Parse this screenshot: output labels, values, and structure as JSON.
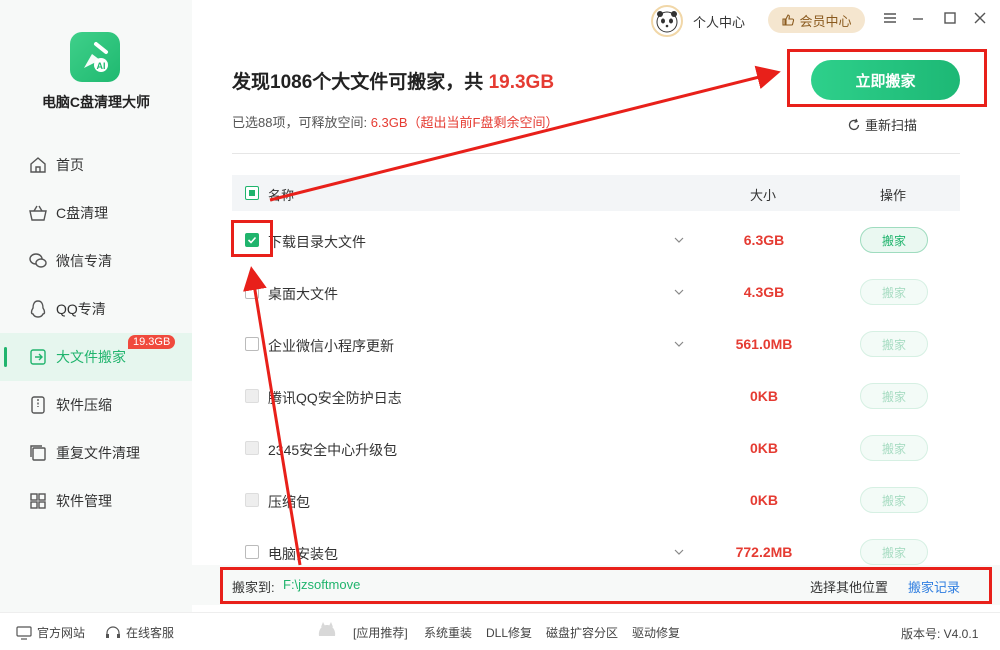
{
  "app": {
    "name": "电脑C盘清理大师",
    "logo_text": "AI"
  },
  "sidebar": {
    "items": [
      {
        "label": "首页",
        "icon": "home-icon"
      },
      {
        "label": "C盘清理",
        "icon": "basket-icon"
      },
      {
        "label": "微信专清",
        "icon": "wechat-icon"
      },
      {
        "label": "QQ专清",
        "icon": "qq-icon"
      },
      {
        "label": "大文件搬家",
        "icon": "move-file-icon",
        "badge": "19.3GB",
        "active": true
      },
      {
        "label": "软件压缩",
        "icon": "compress-icon"
      },
      {
        "label": "重复文件清理",
        "icon": "duplicate-icon"
      },
      {
        "label": "软件管理",
        "icon": "apps-icon"
      }
    ]
  },
  "topbar": {
    "user_center": "个人中心",
    "vip_label": "会员中心"
  },
  "main": {
    "heading_prefix": "发现1086个大文件可搬家，共 ",
    "heading_total": "19.3GB",
    "sub_prefix": "已选88项，可释放空间: ",
    "sub_free": "6.3GB",
    "sub_note": "（超出当前F盘剩余空间）",
    "move_now": "立即搬家",
    "rescan": "重新扫描"
  },
  "table": {
    "headers": {
      "name": "名称",
      "size": "大小",
      "op": "操作"
    },
    "rows": [
      {
        "name": "下载目录大文件",
        "size": "6.3GB",
        "op": "搬家",
        "checked": true,
        "expandable": true,
        "enabled": true
      },
      {
        "name": "桌面大文件",
        "size": "4.3GB",
        "op": "搬家",
        "checked": false,
        "expandable": true,
        "enabled": false
      },
      {
        "name": "企业微信小程序更新",
        "size": "561.0MB",
        "op": "搬家",
        "checked": false,
        "expandable": true,
        "enabled": false
      },
      {
        "name": "腾讯QQ安全防护日志",
        "size": "0KB",
        "op": "搬家",
        "checked": false,
        "expandable": false,
        "enabled": false,
        "disabled_cb": true
      },
      {
        "name": "2345安全中心升级包",
        "size": "0KB",
        "op": "搬家",
        "checked": false,
        "expandable": false,
        "enabled": false,
        "disabled_cb": true
      },
      {
        "name": "压缩包",
        "size": "0KB",
        "op": "搬家",
        "checked": false,
        "expandable": false,
        "enabled": false,
        "disabled_cb": true
      },
      {
        "name": "电脑安装包",
        "size": "772.2MB",
        "op": "搬家",
        "checked": false,
        "expandable": true,
        "enabled": false
      }
    ]
  },
  "pathbar": {
    "label": "搬家到:",
    "path": "F:\\jzsoftmove",
    "choose_other": "选择其他位置",
    "record": "搬家记录"
  },
  "footer": {
    "official_site": "官方网站",
    "online_service": "在线客服",
    "links": [
      "[应用推荐]",
      "系统重装",
      "DLL修复",
      "磁盘扩容分区",
      "驱动修复"
    ],
    "version": "版本号: V4.0.1"
  },
  "colors": {
    "accent": "#20b46d",
    "danger": "#e53b32",
    "annotation": "#e8201a"
  }
}
